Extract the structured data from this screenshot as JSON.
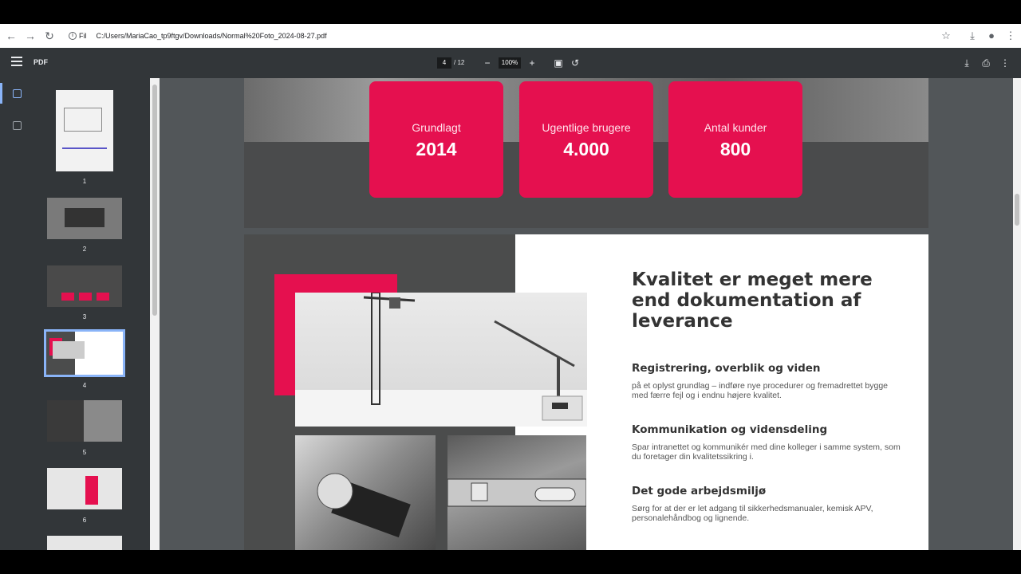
{
  "browser": {
    "site_info": "Fil",
    "url": "C:/Users/MariaCao_tp9ftgv/Downloads/Normal%20Foto_2024-08-27.pdf"
  },
  "pdf_toolbar": {
    "title": "PDF",
    "current_page": "4",
    "total_pages": "/ 12",
    "zoom": "100%"
  },
  "thumbnails": [
    "1",
    "2",
    "3",
    "4",
    "5",
    "6"
  ],
  "stats": [
    {
      "label": "Grundlagt",
      "value": "2014"
    },
    {
      "label": "Ugentlige brugere",
      "value": "4.000"
    },
    {
      "label": "Antal kunder",
      "value": "800"
    }
  ],
  "page4": {
    "headline": "Kvalitet er meget mere end dokumentation af leverance",
    "sections": [
      {
        "title": "Registrering, overblik og viden",
        "body": "på et oplyst grundlag – indføre nye procedurer og fremadrettet bygge med færre fejl og i endnu højere kvalitet."
      },
      {
        "title": "Kommunikation og vidensdeling",
        "body": "Spar intranettet og kommunikér med dine kolleger i samme system, som du foretager din kvalitetssikring i."
      },
      {
        "title": "Det gode arbejdsmiljø",
        "body": "Sørg for at der er let adgang til sikkerhedsmanualer, kemisk APV, personalehåndbog og lignende."
      }
    ]
  },
  "colors": {
    "accent": "#e5104f",
    "toolbar": "#323639",
    "viewer_bg": "#525659"
  }
}
